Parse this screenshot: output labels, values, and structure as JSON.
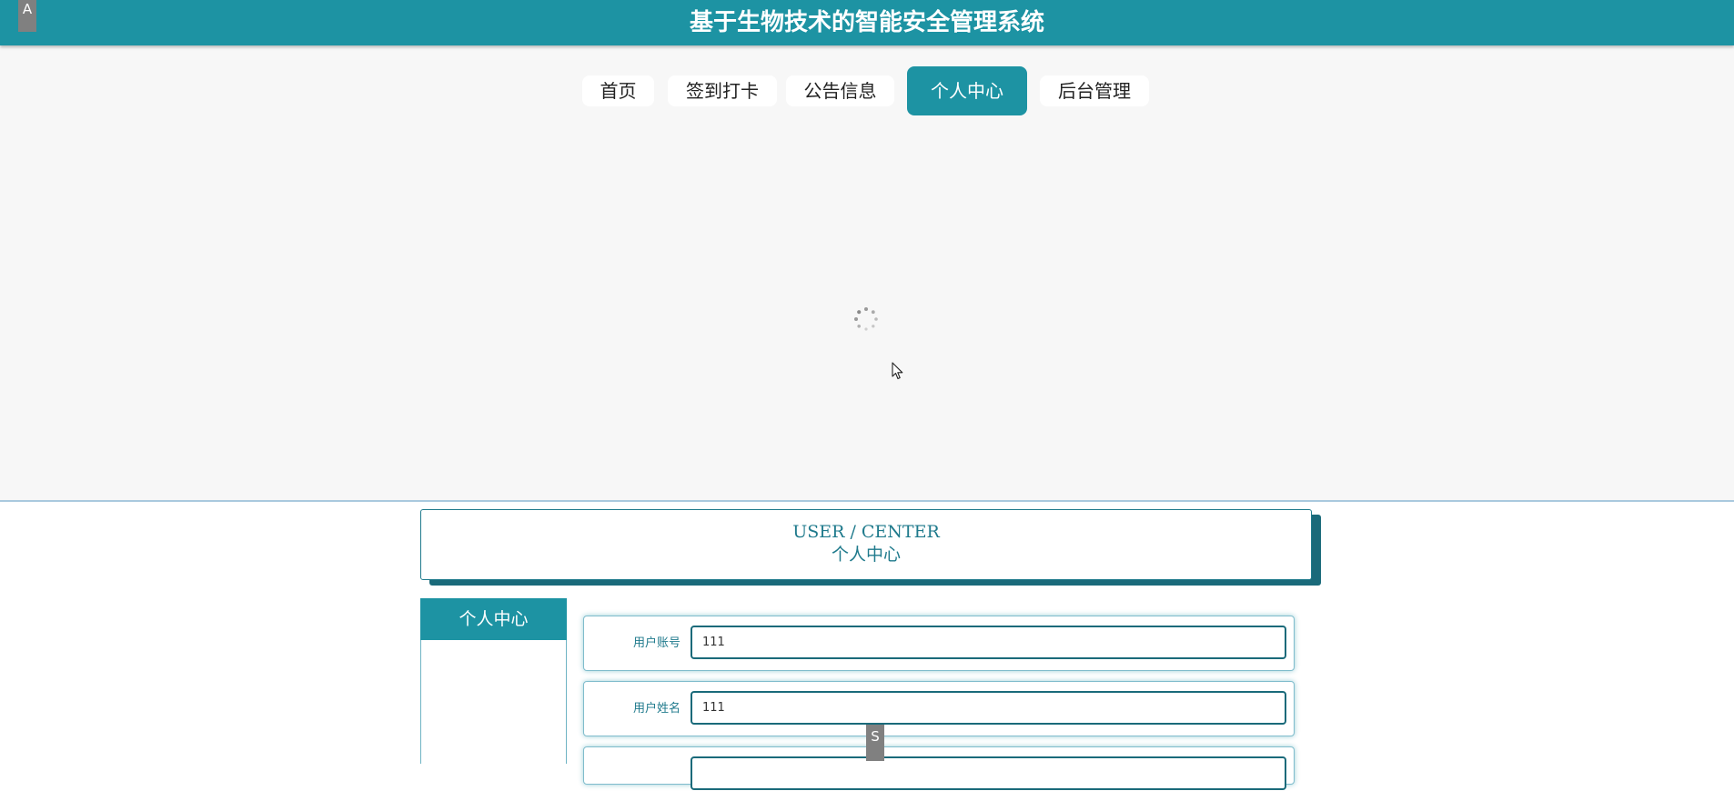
{
  "header": {
    "title": "基于生物技术的智能安全管理系统"
  },
  "nav": {
    "items": [
      {
        "label": "首页"
      },
      {
        "label": "签到打卡"
      },
      {
        "label": "公告信息"
      },
      {
        "label": "个人中心",
        "active": true
      },
      {
        "label": "后台管理"
      }
    ]
  },
  "corner": {
    "a_label": "A",
    "s_label": "S"
  },
  "section": {
    "title_en": "USER / CENTER",
    "title_cn": "个人中心"
  },
  "side_menu": {
    "title": "个人中心"
  },
  "form": {
    "fields": [
      {
        "label": "用户账号",
        "value": "111"
      },
      {
        "label": "用户姓名",
        "value": "111"
      },
      {
        "label": "",
        "value": ""
      }
    ]
  },
  "colors": {
    "primary": "#1d93a3",
    "dark": "#1a6a7a",
    "background": "#f7f7f7"
  },
  "icons": {
    "spinner": "loading-spinner-icon",
    "cursor": "mouse-pointer-icon"
  }
}
